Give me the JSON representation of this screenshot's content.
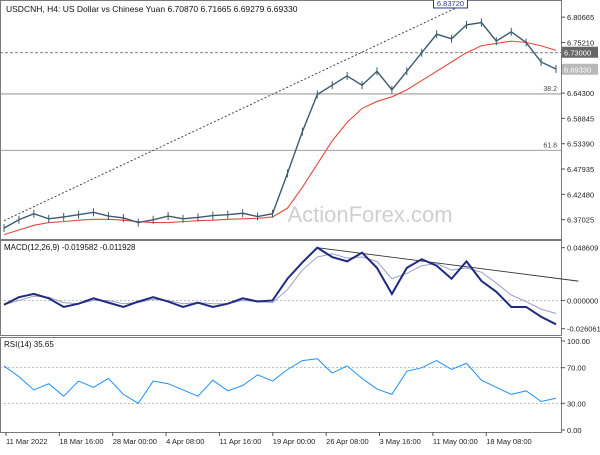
{
  "header": {
    "symbol": "USDCNH, H4:",
    "description": "US Dollar vs Chinese Yuan",
    "ohlc": "6.70870 6.71665 6.69279 6.69330"
  },
  "watermark": "ActionForex.com",
  "chart_data": [
    {
      "type": "line",
      "panel": "price",
      "x_labels": [
        "11 Mar 2022",
        "18 Mar 16:00",
        "28 Mar 00:00",
        "4 Apr 08:00",
        "11 Apr 16:00",
        "19 Apr 00:00",
        "26 Apr 08:00",
        "3 May 16:00",
        "11 May 00:00",
        "18 May 08:00"
      ],
      "y_ticks": [
        6.80665,
        6.7521,
        6.69755,
        6.643,
        6.58845,
        6.5339,
        6.47935,
        6.4248,
        6.37025
      ],
      "ylim": [
        6.335,
        6.835
      ],
      "series": [
        {
          "values": [
            6.352,
            6.37,
            6.383,
            6.372,
            6.376,
            6.381,
            6.386,
            6.378,
            6.374,
            6.364,
            6.37,
            6.378,
            6.372,
            6.375,
            6.379,
            6.381,
            6.384,
            6.377,
            6.383,
            6.47,
            6.56,
            6.64,
            6.66,
            6.68,
            6.66,
            6.69,
            6.65,
            6.69,
            6.73,
            6.77,
            6.76,
            6.79,
            6.795,
            6.755,
            6.775,
            6.752,
            6.71,
            6.695
          ]
        },
        {
          "name": "moving-average",
          "values": [
            6.338,
            6.348,
            6.358,
            6.364,
            6.366,
            6.369,
            6.371,
            6.371,
            6.369,
            6.366,
            6.364,
            6.364,
            6.366,
            6.368,
            6.369,
            6.371,
            6.372,
            6.373,
            6.376,
            6.395,
            6.44,
            6.49,
            6.54,
            6.58,
            6.61,
            6.625,
            6.635,
            6.65,
            6.67,
            6.69,
            6.71,
            6.73,
            6.745,
            6.75,
            6.755,
            6.752,
            6.745,
            6.735
          ],
          "color": "#e04a3c"
        }
      ],
      "levels": [
        {
          "label": "38.2",
          "value": 6.6412
        },
        {
          "label": "61.8",
          "value": 6.5198
        }
      ],
      "current_line_value": 6.73,
      "price_badges": [
        {
          "text": "6.83720",
          "value": 6.8372
        },
        {
          "text": "6.73000",
          "value": 6.73
        },
        {
          "text": "6.69330",
          "value": 6.6933
        }
      ],
      "trendline": {
        "from": {
          "x": 0.0,
          "y": 6.368
        },
        "to": {
          "x": 31.0,
          "y": 6.8372
        }
      },
      "colors": {
        "price": "#3c5a6e",
        "ma": "#e04a3c",
        "grid": "#808080"
      }
    },
    {
      "type": "line",
      "panel": "macd",
      "title": "MACD(12,26,9) -0.019582 -0.011928",
      "y_ticks": [
        0.048609,
        0.0,
        -0.026061
      ],
      "ylim": [
        -0.03,
        0.052
      ],
      "series": [
        {
          "name": "macd",
          "values": [
            -0.004,
            0.003,
            0.006,
            0.002,
            -0.006,
            -0.003,
            0.002,
            -0.002,
            -0.006,
            -0.001,
            0.003,
            -0.001,
            -0.006,
            -0.002,
            -0.006,
            -0.003,
            0.002,
            -0.001,
            0.0,
            0.02,
            0.035,
            0.048609,
            0.04,
            0.036,
            0.044,
            0.03,
            0.006,
            0.03,
            0.038,
            0.032,
            0.02,
            0.036,
            0.018,
            0.008,
            -0.006,
            -0.006,
            -0.015,
            -0.022
          ]
        },
        {
          "name": "signal",
          "values": [
            -0.004,
            0.0,
            0.004,
            0.003,
            -0.002,
            -0.003,
            0.0,
            0.0,
            -0.003,
            -0.002,
            0.001,
            0.0,
            -0.003,
            -0.002,
            -0.003,
            -0.003,
            0.0,
            -0.001,
            -0.002,
            0.01,
            0.028,
            0.04,
            0.043,
            0.039,
            0.04,
            0.036,
            0.02,
            0.025,
            0.032,
            0.034,
            0.028,
            0.03,
            0.026,
            0.016,
            0.005,
            -0.001,
            -0.008,
            -0.012
          ]
        }
      ],
      "trendline": {
        "from": {
          "x": 21.0,
          "y": 0.048609
        },
        "to": {
          "x": 38.5,
          "y": 0.0178
        }
      }
    },
    {
      "type": "line",
      "panel": "rsi",
      "title": "RSI(14) 35.65",
      "y_ticks": [
        100.0,
        70.0,
        30.0,
        0.0
      ],
      "y_tick_labels": [
        "100.00",
        "70.00",
        "30.00",
        "0.00"
      ],
      "ylim": [
        0,
        100
      ],
      "series": [
        {
          "values": [
            72,
            60,
            45,
            52,
            38,
            55,
            48,
            58,
            40,
            30,
            55,
            52,
            45,
            38,
            56,
            44,
            50,
            62,
            55,
            68,
            78,
            80,
            64,
            72,
            58,
            46,
            40,
            66,
            70,
            78,
            68,
            75,
            56,
            48,
            40,
            44,
            32,
            35.65
          ]
        }
      ]
    }
  ]
}
